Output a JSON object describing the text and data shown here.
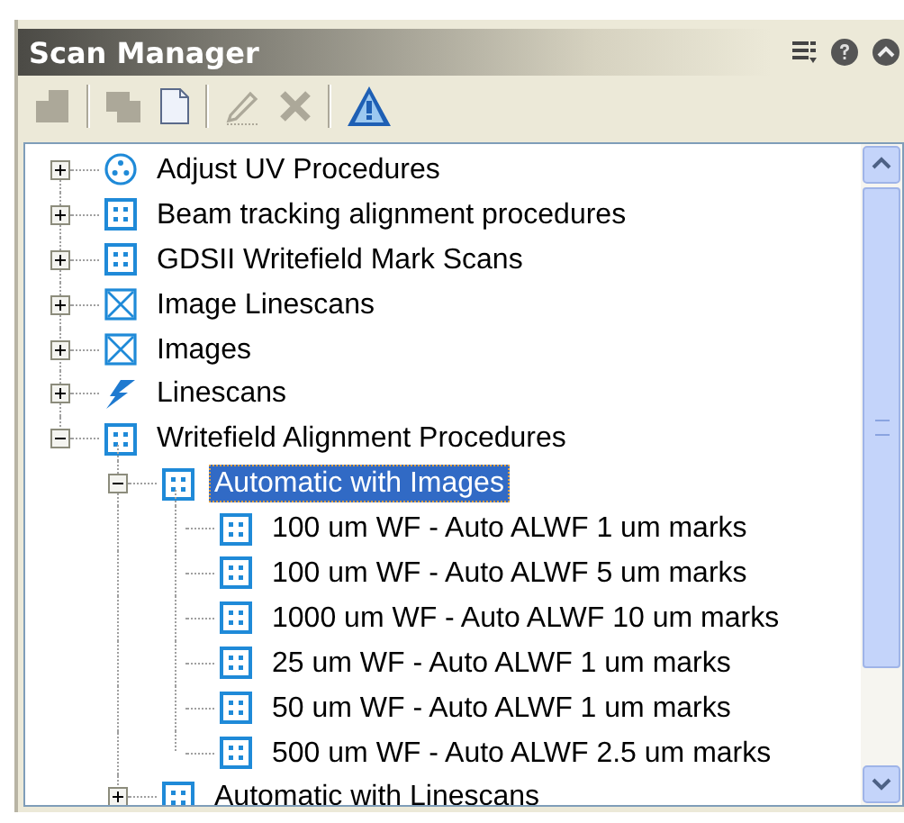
{
  "window": {
    "title": "Scan Manager"
  },
  "toolbar": [
    {
      "kind": "stack",
      "disabled": true
    },
    {
      "kind": "copy",
      "disabled": true
    },
    {
      "kind": "page",
      "disabled": false
    },
    {
      "kind": "pencil",
      "disabled": true
    },
    {
      "kind": "delete",
      "disabled": true
    },
    {
      "kind": "warning",
      "disabled": false
    }
  ],
  "tree": [
    {
      "label": "Adjust UV Procedures",
      "kind": "circle",
      "expanded": false,
      "selected": false
    },
    {
      "label": "Beam tracking alignment procedures",
      "kind": "grid",
      "expanded": false,
      "selected": false
    },
    {
      "label": "GDSII Writefield Mark Scans",
      "kind": "grid",
      "expanded": false,
      "selected": false
    },
    {
      "label": "Image Linescans",
      "kind": "cross",
      "expanded": false,
      "selected": false
    },
    {
      "label": "Images",
      "kind": "cross",
      "expanded": false,
      "selected": false
    },
    {
      "label": "Linescans",
      "kind": "bolt",
      "expanded": false,
      "selected": false
    },
    {
      "label": "Writefield Alignment Procedures",
      "kind": "grid",
      "expanded": true,
      "selected": false,
      "children": [
        {
          "label": "Automatic with Images",
          "kind": "grid",
          "expanded": true,
          "selected": true,
          "children": [
            {
              "label": "100 um WF - Auto ALWF 1 um marks",
              "kind": "grid",
              "selected": false
            },
            {
              "label": "100 um WF - Auto ALWF 5 um marks",
              "kind": "grid",
              "selected": false
            },
            {
              "label": "1000 um WF - Auto ALWF 10 um marks",
              "kind": "grid",
              "selected": false
            },
            {
              "label": "25 um WF - Auto ALWF 1 um marks",
              "kind": "grid",
              "selected": false
            },
            {
              "label": "50 um WF - Auto ALWF 1 um marks",
              "kind": "grid",
              "selected": false
            },
            {
              "label": "500 um WF - Auto ALWF 2.5 um marks",
              "kind": "grid",
              "selected": false
            }
          ]
        },
        {
          "label": "Automatic with Linescans",
          "kind": "grid",
          "expanded": false,
          "selected": false
        }
      ]
    }
  ]
}
